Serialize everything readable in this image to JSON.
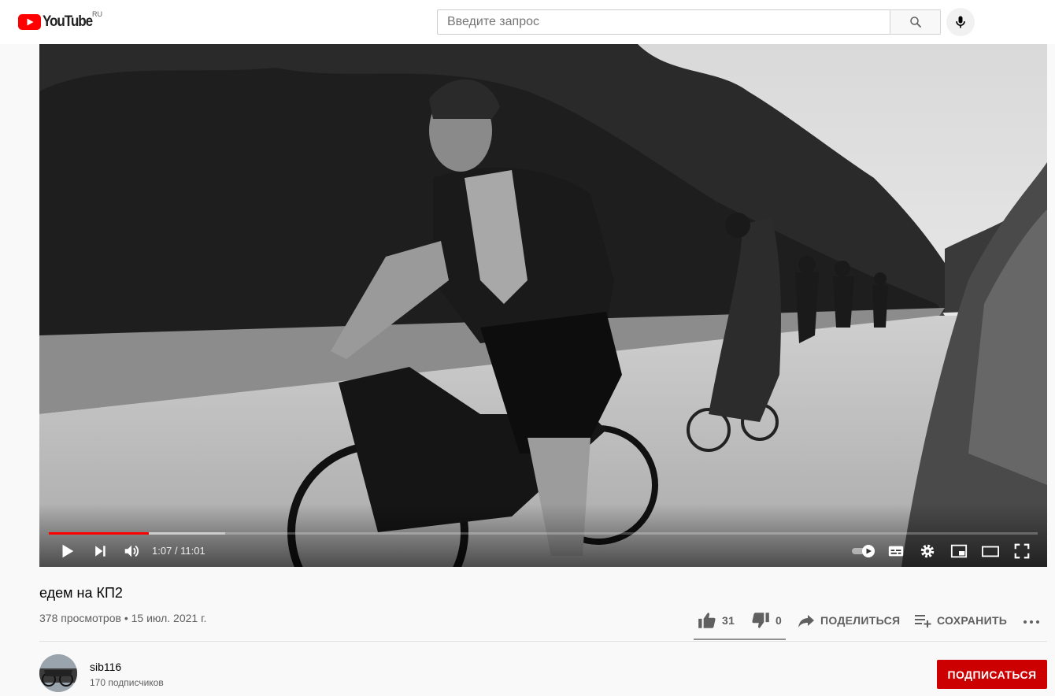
{
  "header": {
    "logo_text": "YouTube",
    "region": "RU",
    "search_placeholder": "Введите запрос"
  },
  "player": {
    "current_time": "1:07",
    "duration": "11:01",
    "time_display": "1:07 / 11:01",
    "played_fraction": 0.101,
    "loaded_fraction": 0.178,
    "accent_color": "#ff0000"
  },
  "video": {
    "title": "едем на КП2",
    "meta": "378 просмотров • 15 июл. 2021 г."
  },
  "actions": {
    "likes": "31",
    "dislikes": "0",
    "share_label": "ПОДЕЛИТЬСЯ",
    "save_label": "СОХРАНИТЬ"
  },
  "channel": {
    "name": "sib116",
    "subscribers": "170 подписчиков",
    "subscribe_label": "ПОДПИСАТЬСЯ",
    "subscribe_color": "#cc0000"
  }
}
